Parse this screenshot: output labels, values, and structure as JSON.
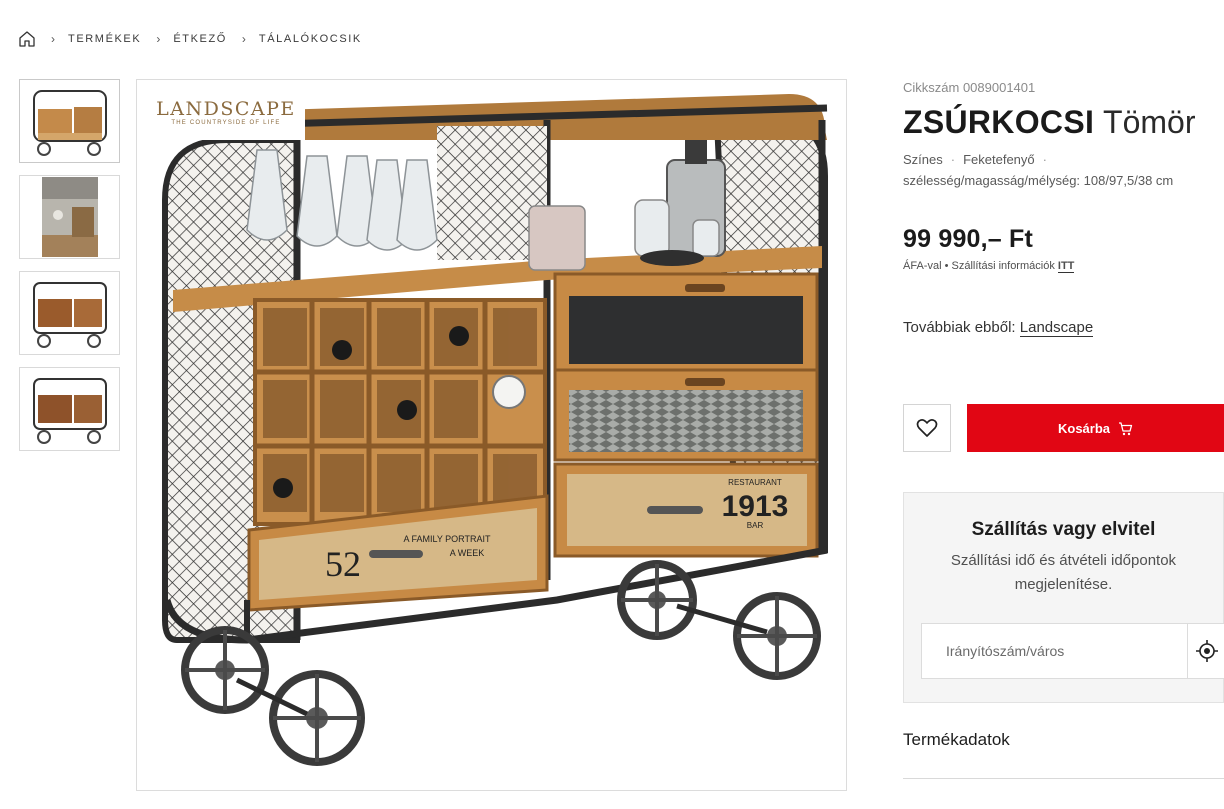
{
  "breadcrumb": {
    "items": [
      "TERMÉKEK",
      "ÉTKEZŐ",
      "TÁLALÓKOCSIK"
    ]
  },
  "gallery": {
    "thumbnails": [
      "product-front",
      "room-scene",
      "product-detail",
      "product-angle"
    ],
    "brand_logo": {
      "name": "LANDSCAPE",
      "tagline": "THE COUNTRYSIDE OF LIFE"
    },
    "drawer_labels": [
      "52",
      "A FAMILY PORTRAIT",
      "A WEEK",
      "RESTAURANT",
      "1913",
      "BAR"
    ]
  },
  "product": {
    "sku": "Cikkszám 0089001401",
    "title_bold": "ZSÚRKOCSI",
    "title_rest": "Tömör",
    "attr_color": "Színes",
    "attr_wood": "Feketefenyő",
    "attr_dims": "szélesség/magasság/mélység: 108/97,5/38 cm",
    "price": "99 990,– Ft",
    "price_note_vat": "ÁFA-val",
    "price_note_shipping": "Szállítási információk",
    "price_note_link": "ITT",
    "more_from_label": "Továbbiak ebből:",
    "more_from_brand": "Landscape"
  },
  "actions": {
    "cart_label": "Kosárba",
    "wishlist_icon": "heart-icon",
    "cart_icon": "cart-icon",
    "accent_color": "#e10614"
  },
  "delivery": {
    "title": "Szállítás vagy elvitel",
    "description": "Szállítási idő és átvételi időpontok megjelenítése.",
    "zip_placeholder": "Irányítószám/város",
    "locate_icon": "locate-icon"
  },
  "sections": {
    "product_data": "Termékadatok"
  }
}
